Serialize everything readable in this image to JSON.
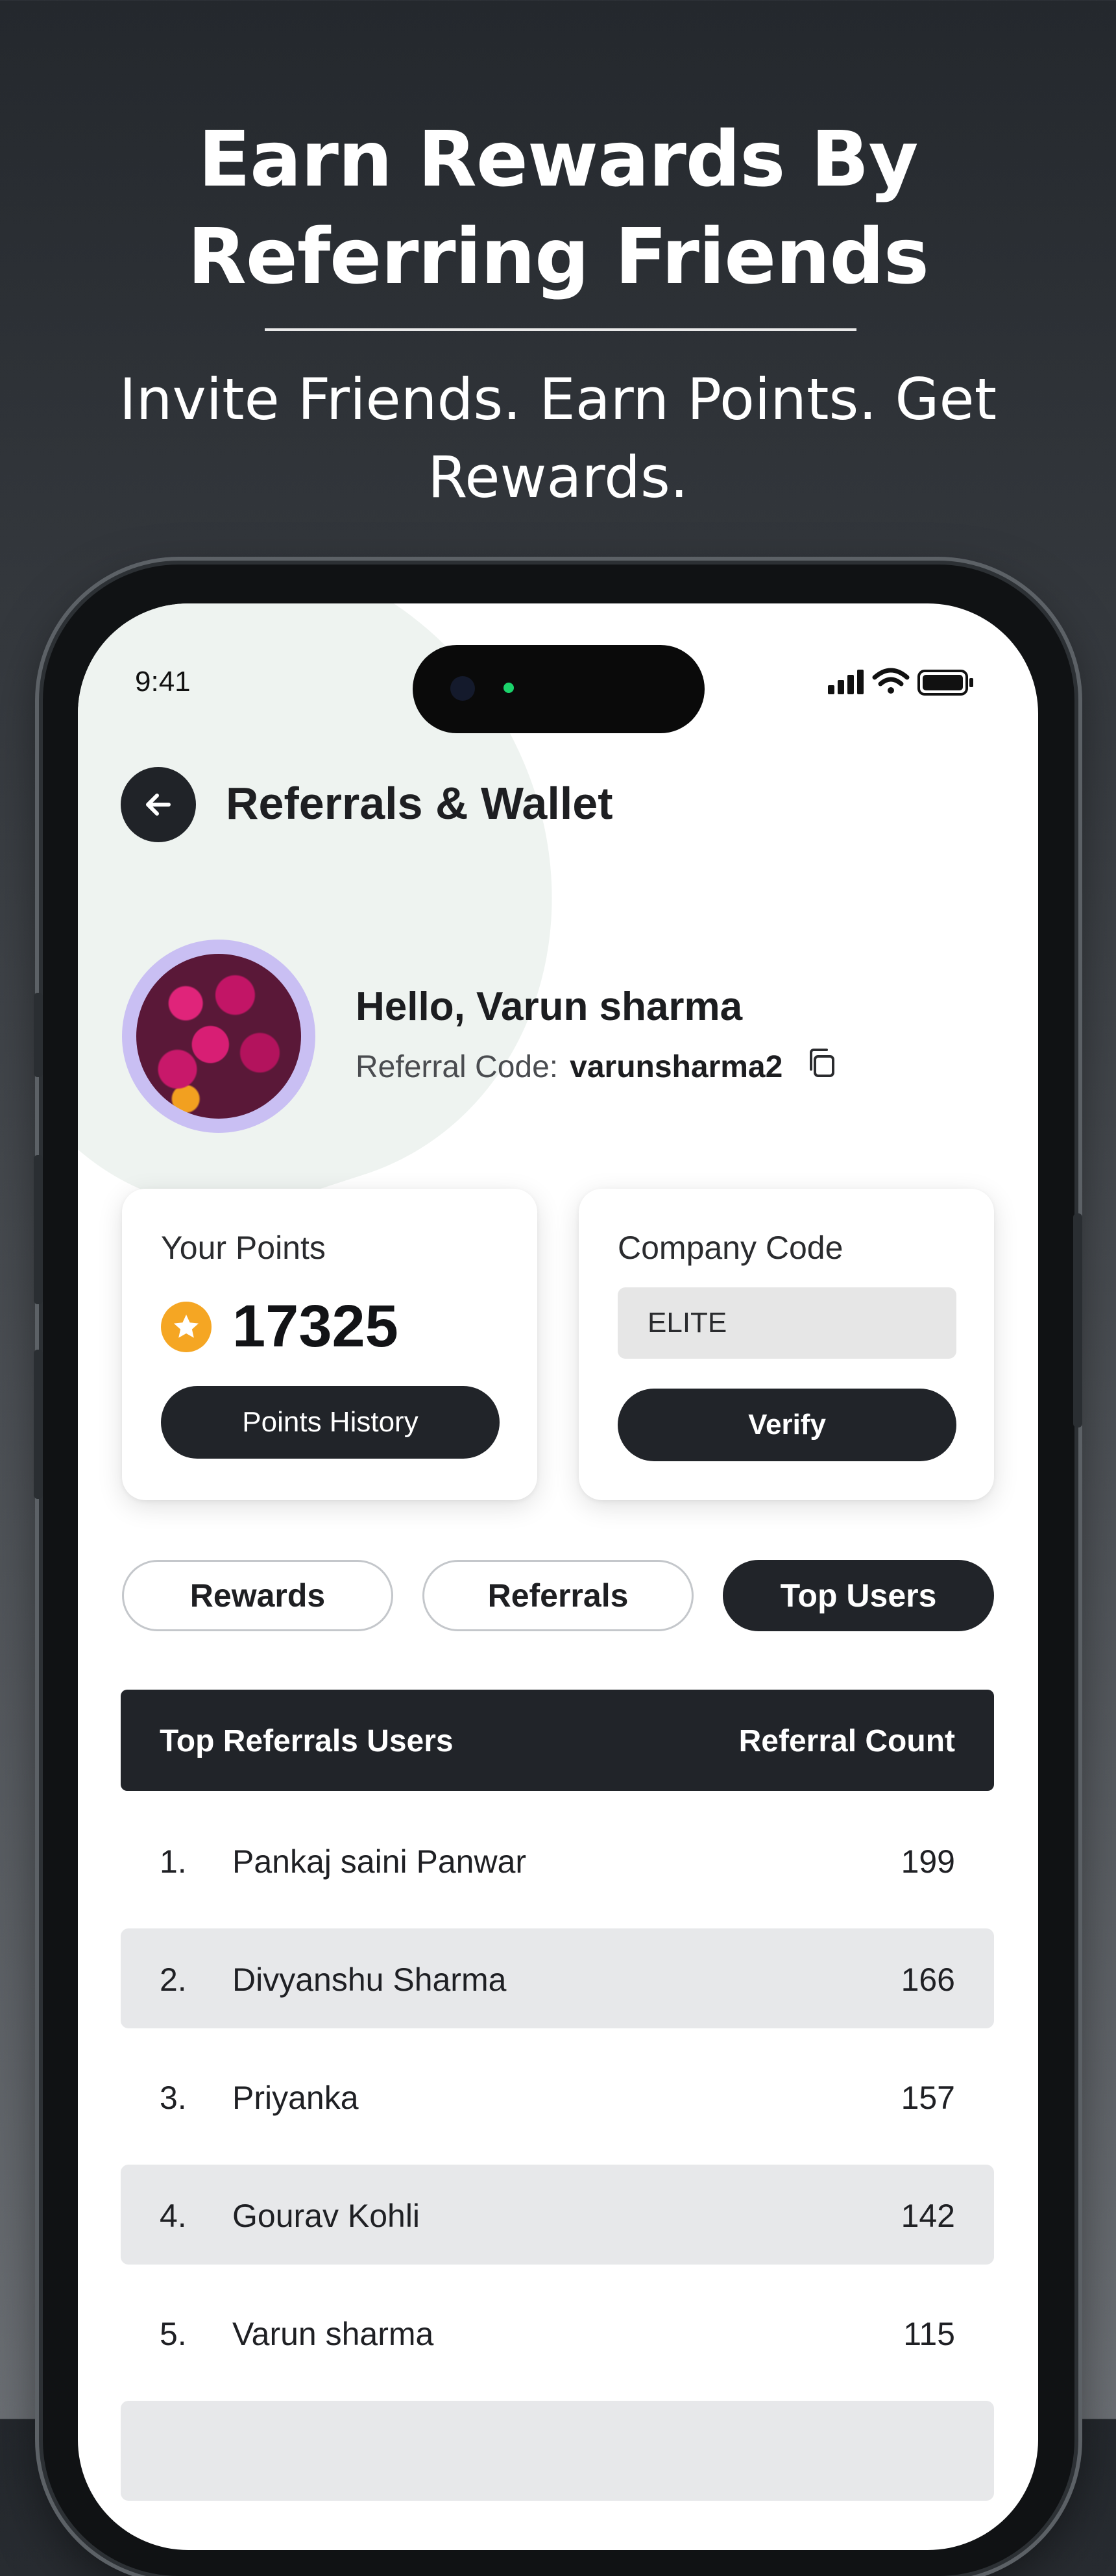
{
  "promo": {
    "title_line1": "Earn Rewards By",
    "title_line2": "Referring Friends",
    "subtitle_line1": "Invite Friends. Earn Points. Get",
    "subtitle_line2": "Rewards."
  },
  "status_bar": {
    "time": "9:41"
  },
  "header": {
    "title": "Referrals & Wallet"
  },
  "profile": {
    "greeting": "Hello, Varun sharma",
    "referral_label": "Referral Code:",
    "referral_code": "varunsharma2"
  },
  "points_card": {
    "label": "Your Points",
    "value": "17325",
    "button": "Points History"
  },
  "company_card": {
    "label": "Company Code",
    "code_value": "ELITE",
    "button": "Verify"
  },
  "tabs": [
    {
      "label": "Rewards",
      "active": false
    },
    {
      "label": "Referrals",
      "active": false
    },
    {
      "label": "Top Users",
      "active": true
    }
  ],
  "table": {
    "header_left": "Top Referrals Users",
    "header_right": "Referral Count",
    "rows": [
      {
        "rank": "1.",
        "name": "Pankaj saini Panwar",
        "count": "199"
      },
      {
        "rank": "2.",
        "name": "Divyanshu Sharma",
        "count": "166"
      },
      {
        "rank": "3.",
        "name": "Priyanka",
        "count": "157"
      },
      {
        "rank": "4.",
        "name": "Gourav Kohli",
        "count": "142"
      },
      {
        "rank": "5.",
        "name": "Varun sharma",
        "count": "115"
      }
    ]
  },
  "colors": {
    "dark": "#212429",
    "accent_star": "#f5a623",
    "avatar_ring": "#c9bff3"
  }
}
